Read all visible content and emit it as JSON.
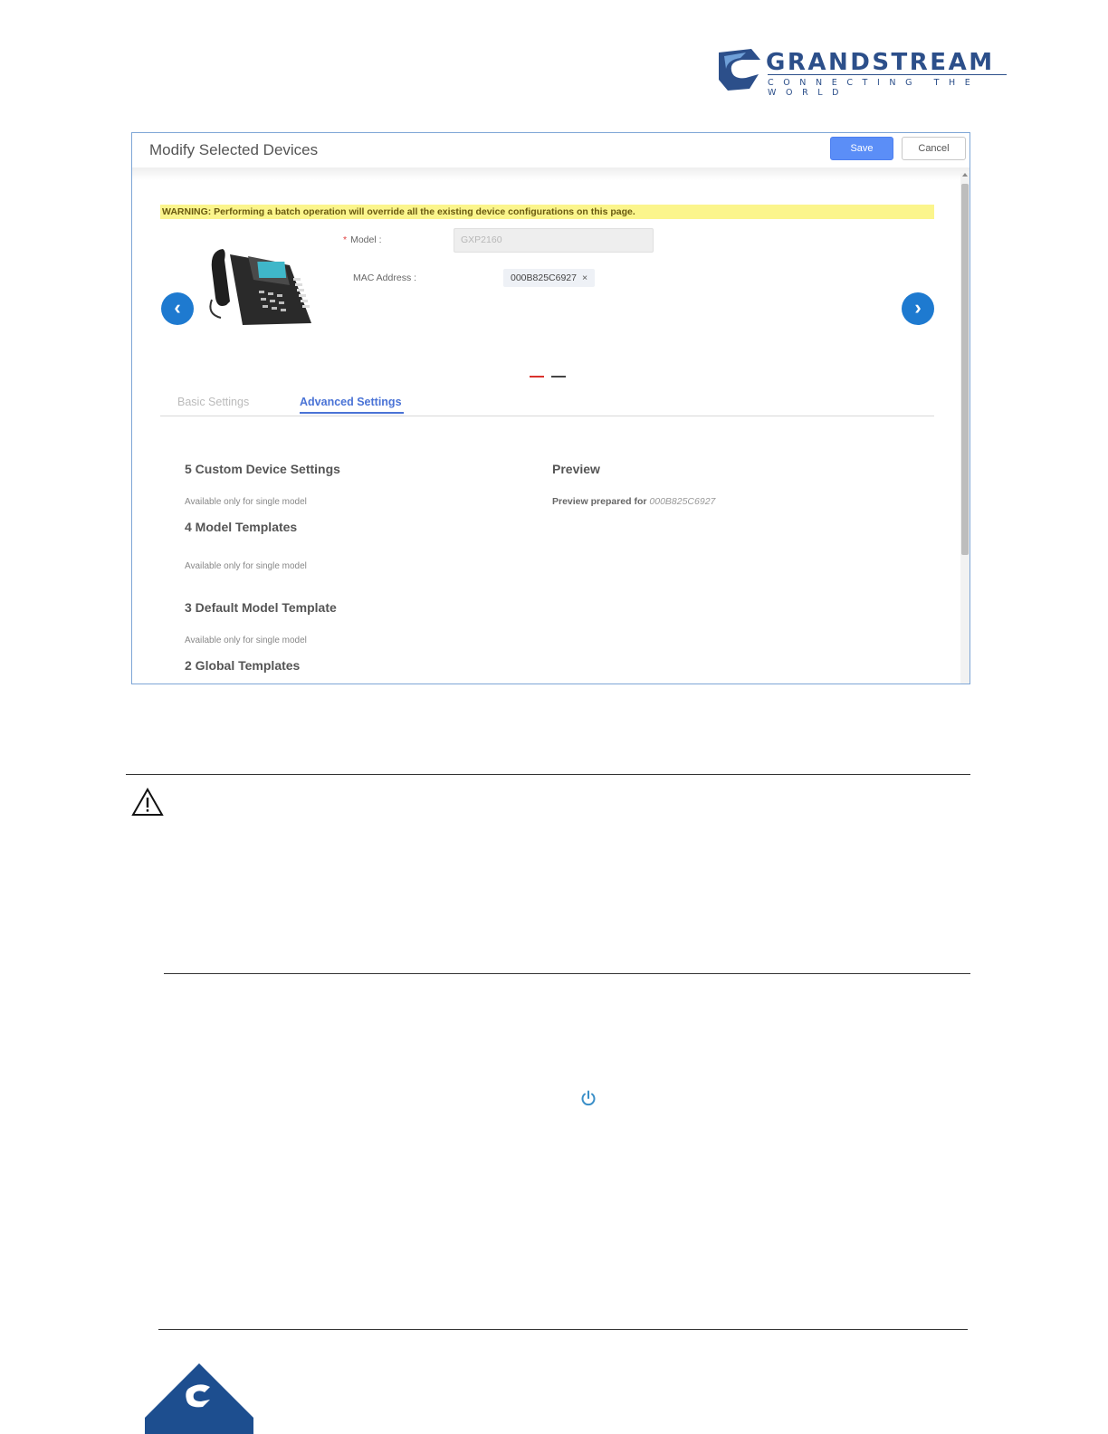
{
  "logo": {
    "brand": "GRANDSTREAM",
    "tagline": "CONNECTING THE WORLD"
  },
  "dialog": {
    "title": "Modify Selected Devices",
    "save_label": "Save",
    "cancel_label": "Cancel",
    "warning": "WARNING: Performing a batch operation will override all the existing device configurations on this page.",
    "model": {
      "label": "Model :",
      "value": "GXP2160"
    },
    "mac": {
      "label": "MAC Address :",
      "tag": "000B825C6927",
      "remove_glyph": "×"
    },
    "nav": {
      "prev_glyph": "‹",
      "next_glyph": "›"
    },
    "tabs": {
      "basic": "Basic Settings",
      "advanced": "Advanced Settings",
      "active": "advanced"
    },
    "sections": [
      {
        "title": "5 Custom Device Settings",
        "note": "Available only for single model"
      },
      {
        "title": "4 Model Templates",
        "note": "Available only for single model"
      },
      {
        "title": "3 Default Model Template",
        "note": "Available only for single model"
      },
      {
        "title": "2 Global Templates"
      }
    ],
    "preview": {
      "title": "Preview",
      "label": "Preview prepared for",
      "mac": "000B825C6927"
    }
  },
  "colors": {
    "brand": "#2c4f8a",
    "primary_button": "#5b8ef7",
    "nav_arrow": "#1e7ad0",
    "warning_bg": "#fbf58c",
    "active_tab": "#4a73d6"
  },
  "icons": [
    "grandstream-logo-icon",
    "phone-image",
    "chevron-left-icon",
    "chevron-right-icon",
    "warning-icon",
    "power-icon",
    "footer-logo-icon"
  ]
}
